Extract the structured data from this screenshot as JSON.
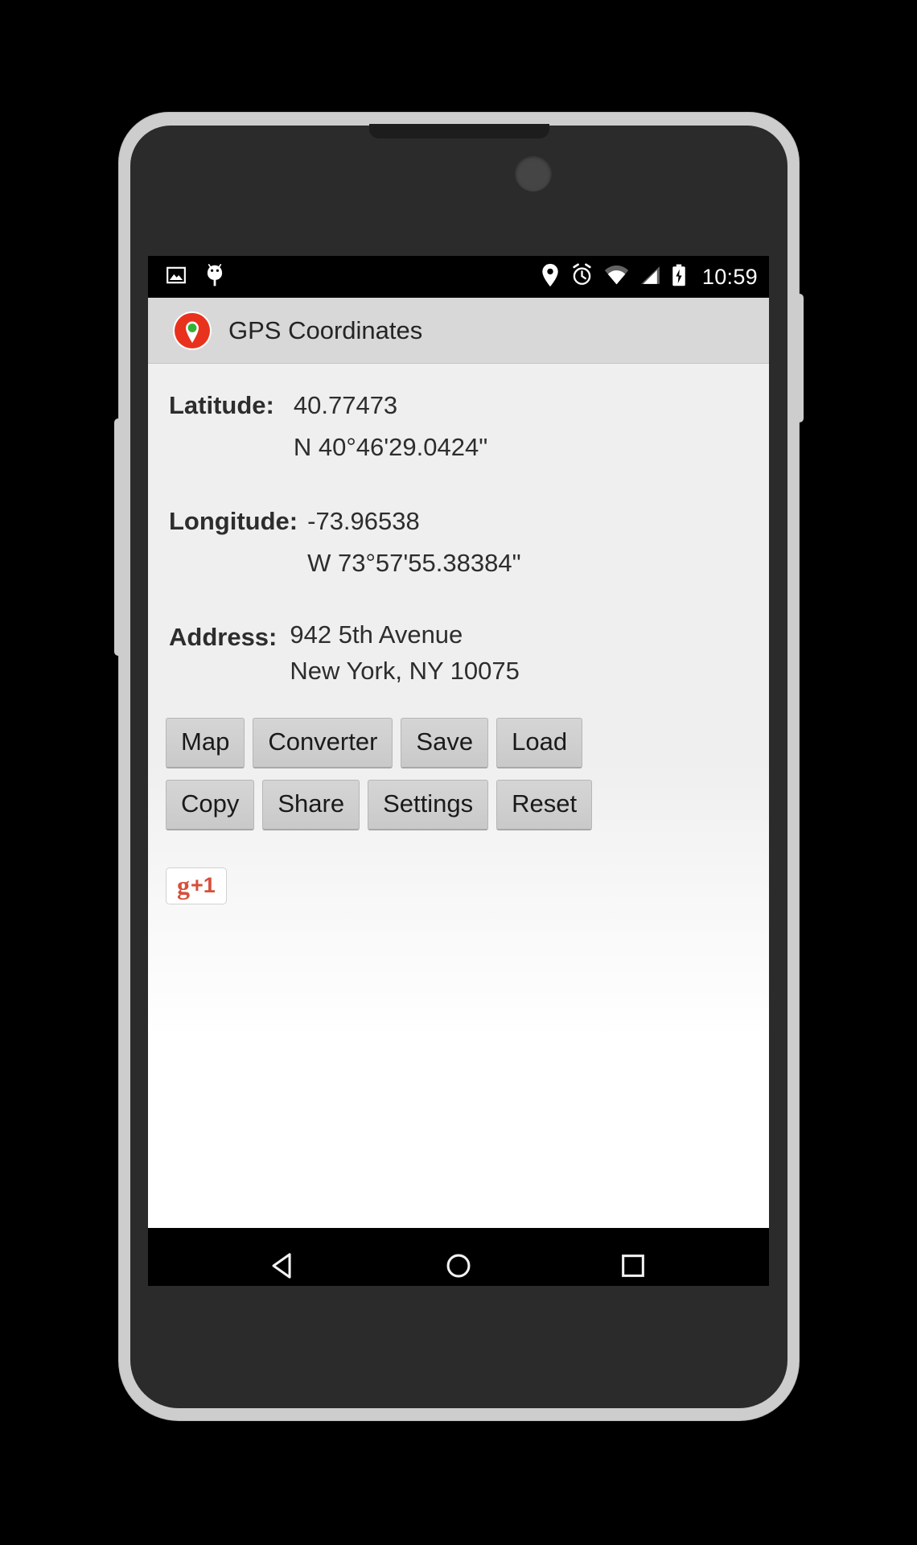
{
  "device": {
    "frame_color": "#cdcdcd",
    "body_color": "#2b2b2b"
  },
  "status_bar": {
    "background": "#000000",
    "left_icons": [
      {
        "name": "screenshot-image-icon",
        "label": "Screenshot"
      },
      {
        "name": "android-debug-icon",
        "label": "Android"
      }
    ],
    "right_icons": [
      {
        "name": "location-pin-icon",
        "label": "Location"
      },
      {
        "name": "alarm-clock-icon",
        "label": "Alarm"
      },
      {
        "name": "wifi-icon",
        "label": "Wi-Fi"
      },
      {
        "name": "cell-signal-icon",
        "label": "Signal"
      },
      {
        "name": "battery-charging-icon",
        "label": "Battery charging"
      }
    ],
    "time": "10:59"
  },
  "action_bar": {
    "background": "#d8d8d8",
    "app_icon": "gps-map-pin-icon",
    "title": "GPS Coordinates",
    "icon_colors": {
      "pin_red": "#e8321e",
      "dot_green": "#34b233",
      "ring_white": "#ffffff"
    }
  },
  "main": {
    "fields": [
      {
        "label": "Latitude:",
        "name": "latitude",
        "values": [
          "40.77473",
          "N 40°46'29.0424\""
        ]
      },
      {
        "label": "Longitude:",
        "name": "longitude",
        "values": [
          "-73.96538",
          "W 73°57'55.38384\""
        ]
      },
      {
        "label": "Address:",
        "name": "address",
        "values": [
          "942 5th Avenue",
          "New York, NY 10075"
        ]
      }
    ],
    "button_rows": [
      [
        {
          "label": "Map",
          "name": "map-button"
        },
        {
          "label": "Converter",
          "name": "converter-button"
        },
        {
          "label": "Save",
          "name": "save-button"
        },
        {
          "label": "Load",
          "name": "load-button"
        }
      ],
      [
        {
          "label": "Copy",
          "name": "copy-button"
        },
        {
          "label": "Share",
          "name": "share-button"
        },
        {
          "label": "Settings",
          "name": "settings-button"
        },
        {
          "label": "Reset",
          "name": "reset-button"
        }
      ]
    ],
    "plus_one": {
      "g_text": "g",
      "plus_text": "+1",
      "accent": "#d6503c"
    }
  },
  "nav_bar": {
    "background": "#000000",
    "keys": [
      {
        "name": "back-button",
        "glyph": "triangle-left"
      },
      {
        "name": "home-button",
        "glyph": "circle"
      },
      {
        "name": "recents-button",
        "glyph": "square"
      }
    ]
  }
}
